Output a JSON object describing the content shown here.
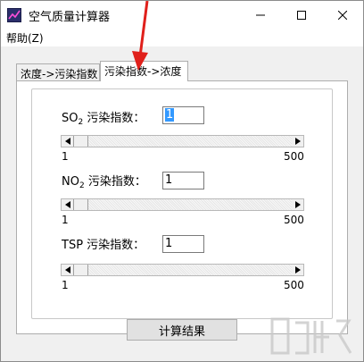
{
  "window": {
    "title": "空气质量计算器",
    "icon": "chart-app-icon",
    "controls": [
      "minimize-icon",
      "maximize-icon",
      "close-icon"
    ]
  },
  "menu": {
    "help": "帮助(Z)"
  },
  "tabs": [
    {
      "label": "浓度->污染指数",
      "active": false
    },
    {
      "label": "污染指数->浓度",
      "active": true
    }
  ],
  "fields": [
    {
      "prefix": "SO",
      "sub": "2",
      "suffix": " 污染指数：",
      "value": "1",
      "min": "1",
      "max": "500",
      "slider_fraction": 0.0
    },
    {
      "prefix": "NO",
      "sub": "2",
      "suffix": " 污染指数：",
      "value": "1",
      "min": "1",
      "max": "500",
      "slider_fraction": 0.0
    },
    {
      "prefix": "TSP",
      "sub": "",
      "suffix": " 污染指数：",
      "value": "1",
      "min": "1",
      "max": "500",
      "slider_fraction": 0.0
    }
  ],
  "calc_button": "计算结果",
  "colors": {
    "selection": "#3399ff",
    "annotation_arrow": "#e0201b"
  },
  "overlay": {
    "watermark_logo": "xiazaiba-watermark-logo"
  }
}
